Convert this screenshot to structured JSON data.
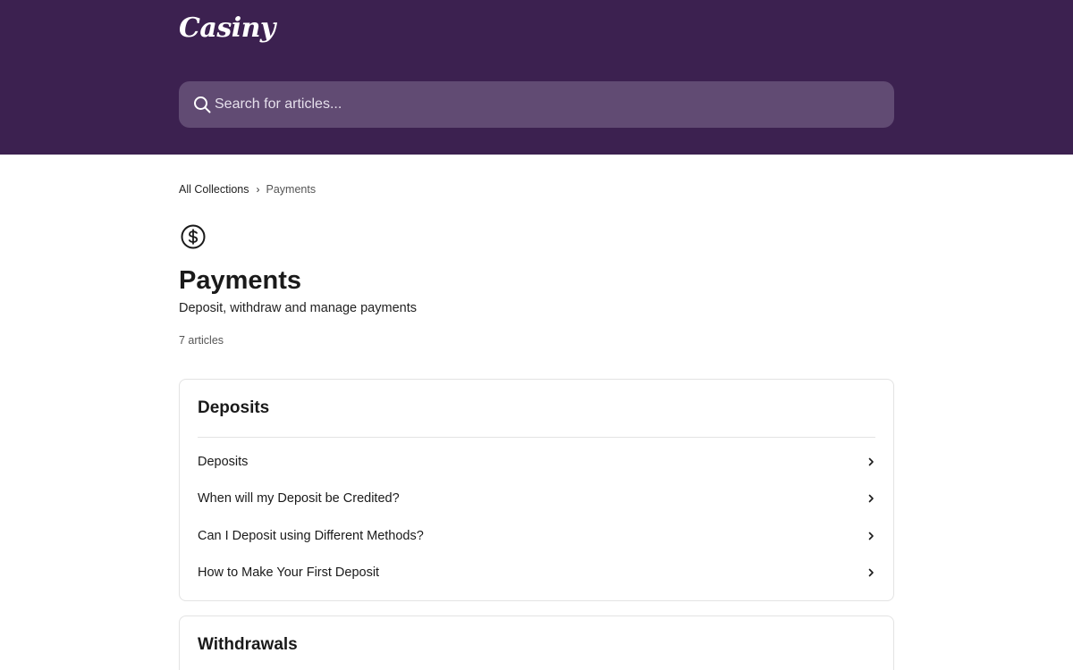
{
  "header": {
    "logo": "Casiny",
    "search_placeholder": "Search for articles..."
  },
  "breadcrumb": {
    "root": "All Collections",
    "current": "Payments"
  },
  "collection": {
    "icon": "dollar-circle-icon",
    "title": "Payments",
    "description": "Deposit, withdraw and manage payments",
    "article_count": "7 articles"
  },
  "sections": [
    {
      "title": "Deposits",
      "articles": [
        "Deposits",
        "When will my Deposit be Credited?",
        "Can I Deposit using Different Methods?",
        "How to Make Your First Deposit"
      ]
    },
    {
      "title": "Withdrawals"
    }
  ],
  "colors": {
    "header_bg": "#3c2150",
    "search_bg": "#614b73"
  }
}
